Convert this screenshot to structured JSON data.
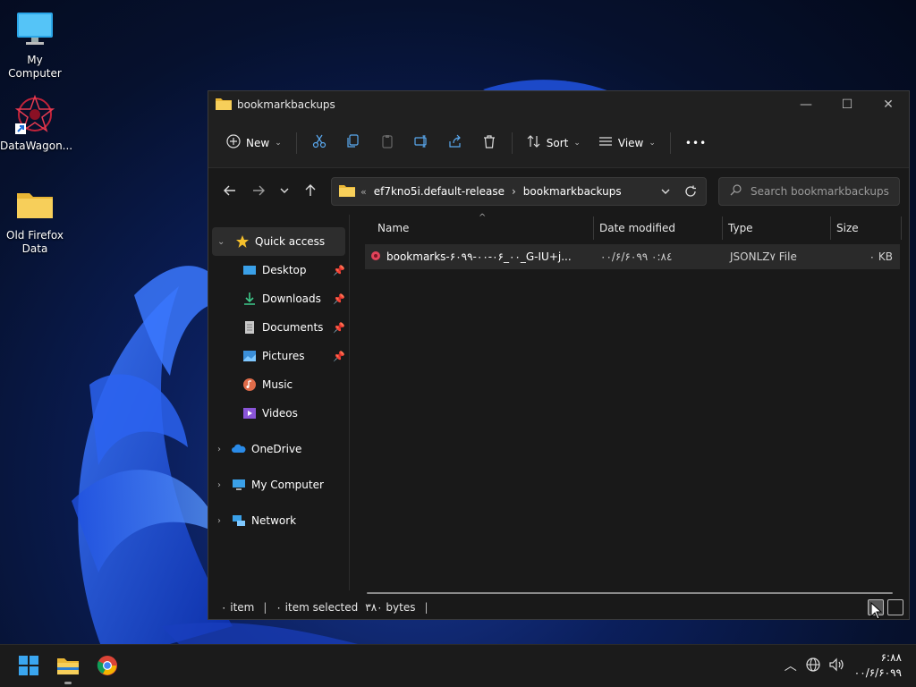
{
  "desktop": {
    "icons": [
      {
        "label": "My Computer",
        "icon": "monitor-icon"
      },
      {
        "label": "DataWagon...",
        "icon": "datawagon-app-icon"
      },
      {
        "label": "Old Firefox Data",
        "icon": "folder-icon"
      }
    ]
  },
  "window": {
    "title": "bookmarkbackups",
    "controls": {
      "minimize": "—",
      "maximize": "☐",
      "close": "✕"
    }
  },
  "toolbar": {
    "new_label": "New",
    "sort_label": "Sort",
    "view_label": "View",
    "more_label": "•••",
    "icons": [
      "cut-icon",
      "copy-icon",
      "paste-icon",
      "rename-icon",
      "share-icon",
      "delete-icon"
    ]
  },
  "address": {
    "overflow": "«",
    "segments": [
      "ef7kno5i.default-release",
      "bookmarkbackups"
    ],
    "separator": "›"
  },
  "search": {
    "placeholder": "Search bookmarkbackups"
  },
  "nav_pane": {
    "quick_access": "Quick access",
    "pinned": [
      {
        "label": "Desktop",
        "icon": "desktop-icon",
        "pinned": true
      },
      {
        "label": "Downloads",
        "icon": "download-icon",
        "pinned": true
      },
      {
        "label": "Documents",
        "icon": "document-icon",
        "pinned": true
      },
      {
        "label": "Pictures",
        "icon": "pictures-icon",
        "pinned": true
      },
      {
        "label": "Music",
        "icon": "music-icon",
        "pinned": false
      },
      {
        "label": "Videos",
        "icon": "videos-icon",
        "pinned": false
      }
    ],
    "roots": [
      {
        "label": "OneDrive",
        "icon": "cloud-icon"
      },
      {
        "label": "My Computer",
        "icon": "monitor-icon"
      },
      {
        "label": "Network",
        "icon": "network-icon"
      }
    ]
  },
  "columns": {
    "name": "Name",
    "date": "Date modified",
    "type": "Type",
    "size": "Size"
  },
  "files": [
    {
      "name": "bookmarks-۶۰۹۹-۰۰-۰۶_۰۰_G-IU+j...",
      "date": "۰۰/۶/۶۰۹۹ ۰:۸٤",
      "type": "JSONLZ۷ File",
      "size": "۰ KB"
    }
  ],
  "status": {
    "items": "۰ item",
    "selected": "۰ item selected",
    "bytes": "۳۸۰ bytes"
  },
  "taskbar": {
    "clock_time": "۶:۸۸",
    "clock_date": "۰۰/۶/۶۰۹۹"
  },
  "colors": {
    "accent": "#0078d4",
    "folder": "#f4c542",
    "window_bg": "#191919"
  }
}
